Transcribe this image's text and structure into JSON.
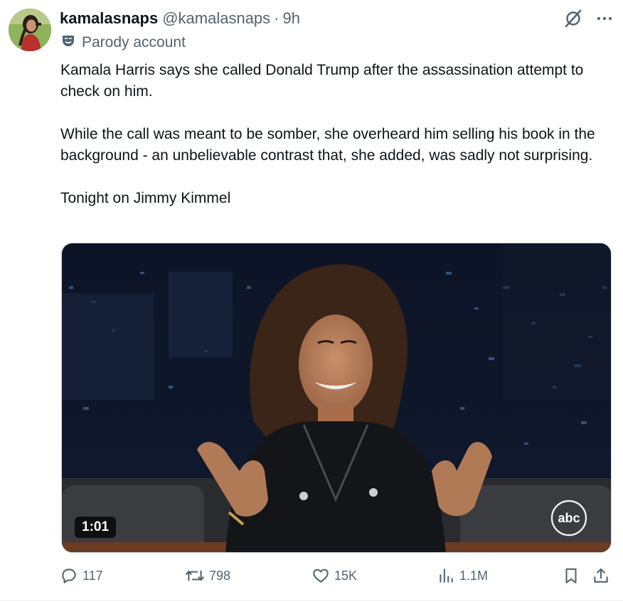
{
  "post": {
    "display_name": "kamalasnaps",
    "handle": "@kamalasnaps",
    "separator": "·",
    "time": "9h",
    "label": "Parody account",
    "paragraphs": [
      "Kamala Harris says she called Donald Trump after the assassination attempt to check on him.",
      "While the call was meant to be somber, she overheard him selling his book in the background - an unbelievable contrast that, she added, was sadly not surprising.",
      "Tonight on Jimmy Kimmel"
    ]
  },
  "media": {
    "duration": "1:01",
    "network_logo": "abc"
  },
  "actions": {
    "replies": "117",
    "reposts": "798",
    "likes": "15K",
    "views": "1.1M"
  },
  "icons": {
    "header": [
      "grok-icon",
      "more-icon"
    ],
    "label": "parody-mask-icon",
    "actions": [
      "reply-icon",
      "retweet-icon",
      "like-icon",
      "views-icon",
      "bookmark-icon",
      "share-icon"
    ]
  },
  "colors": {
    "text": "#0f1419",
    "secondary": "#536471",
    "border": "#cfd9de"
  }
}
